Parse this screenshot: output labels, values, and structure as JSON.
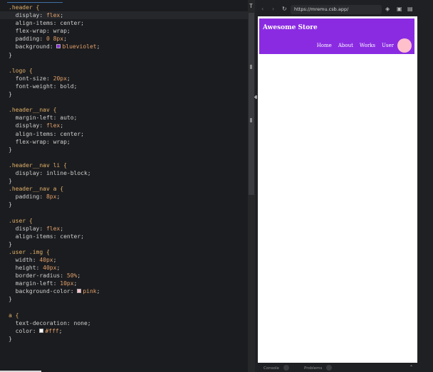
{
  "editor": {
    "lines": [
      [
        {
          "t": ".header {",
          "c": "sel"
        }
      ],
      [
        {
          "t": "  display: ",
          "c": "prop"
        },
        {
          "t": "flex",
          "c": "val"
        },
        {
          "t": ";",
          "c": "prop"
        }
      ],
      [
        {
          "t": "  align-items: center;",
          "c": "prop"
        }
      ],
      [
        {
          "t": "  flex-wrap: wrap;",
          "c": "prop"
        }
      ],
      [
        {
          "t": "  padding: ",
          "c": "prop"
        },
        {
          "t": "0 8px",
          "c": "val"
        },
        {
          "t": ";",
          "c": "prop"
        }
      ],
      [
        {
          "t": "  background: ",
          "c": "prop"
        },
        {
          "sw": "#8a2be2"
        },
        {
          "t": "blueviolet",
          "c": "val"
        },
        {
          "t": ";",
          "c": "prop"
        }
      ],
      [
        {
          "t": "}",
          "c": "prop"
        }
      ],
      [],
      [
        {
          "t": ".logo {",
          "c": "sel"
        }
      ],
      [
        {
          "t": "  font-size: ",
          "c": "prop"
        },
        {
          "t": "20px",
          "c": "val"
        },
        {
          "t": ";",
          "c": "prop"
        }
      ],
      [
        {
          "t": "  font-weight: bold;",
          "c": "prop"
        }
      ],
      [
        {
          "t": "}",
          "c": "prop"
        }
      ],
      [],
      [
        {
          "t": ".header__nav {",
          "c": "sel"
        }
      ],
      [
        {
          "t": "  margin-left: auto;",
          "c": "prop"
        }
      ],
      [
        {
          "t": "  display: ",
          "c": "prop"
        },
        {
          "t": "flex",
          "c": "val"
        },
        {
          "t": ";",
          "c": "prop"
        }
      ],
      [
        {
          "t": "  align-items: center;",
          "c": "prop"
        }
      ],
      [
        {
          "t": "  flex-wrap: wrap;",
          "c": "prop"
        }
      ],
      [
        {
          "t": "}",
          "c": "prop"
        }
      ],
      [],
      [
        {
          "t": ".header__nav li {",
          "c": "sel"
        }
      ],
      [
        {
          "t": "  display: inline-block;",
          "c": "prop"
        }
      ],
      [
        {
          "t": "}",
          "c": "prop"
        }
      ],
      [
        {
          "t": ".header__nav a {",
          "c": "sel"
        }
      ],
      [
        {
          "t": "  padding: ",
          "c": "prop"
        },
        {
          "t": "8px",
          "c": "val"
        },
        {
          "t": ";",
          "c": "prop"
        }
      ],
      [
        {
          "t": "}",
          "c": "prop"
        }
      ],
      [],
      [
        {
          "t": ".user {",
          "c": "sel"
        }
      ],
      [
        {
          "t": "  display: ",
          "c": "prop"
        },
        {
          "t": "flex",
          "c": "val"
        },
        {
          "t": ";",
          "c": "prop"
        }
      ],
      [
        {
          "t": "  align-items: center;",
          "c": "prop"
        }
      ],
      [
        {
          "t": "}",
          "c": "prop"
        }
      ],
      [
        {
          "t": ".user .img {",
          "c": "sel"
        }
      ],
      [
        {
          "t": "  width: ",
          "c": "prop"
        },
        {
          "t": "40px",
          "c": "val"
        },
        {
          "t": ";",
          "c": "prop"
        }
      ],
      [
        {
          "t": "  height: ",
          "c": "prop"
        },
        {
          "t": "40px",
          "c": "val"
        },
        {
          "t": ";",
          "c": "prop"
        }
      ],
      [
        {
          "t": "  border-radius: ",
          "c": "prop"
        },
        {
          "t": "50%",
          "c": "val"
        },
        {
          "t": ";",
          "c": "prop"
        }
      ],
      [
        {
          "t": "  margin-left: ",
          "c": "prop"
        },
        {
          "t": "10px",
          "c": "val"
        },
        {
          "t": ";",
          "c": "prop"
        }
      ],
      [
        {
          "t": "  background-color: ",
          "c": "prop"
        },
        {
          "sw": "#ffc0cb"
        },
        {
          "t": "pink",
          "c": "val"
        },
        {
          "t": ";",
          "c": "prop"
        }
      ],
      [
        {
          "t": "}",
          "c": "prop"
        }
      ],
      [],
      [
        {
          "t": "a {",
          "c": "sel"
        }
      ],
      [
        {
          "t": "  text-decoration: none;",
          "c": "prop"
        }
      ],
      [
        {
          "t": "  color: ",
          "c": "prop"
        },
        {
          "sw": "#ffffff"
        },
        {
          "t": "#fff",
          "c": "val"
        },
        {
          "t": ";",
          "c": "prop"
        }
      ],
      [
        {
          "t": "}",
          "c": "prop"
        }
      ]
    ],
    "highlighted_line": 1
  },
  "browser": {
    "url": "https://mremu.csb.app/",
    "icons": [
      "back-icon",
      "forward-icon",
      "reload-icon",
      "open-external-icon",
      "split-icon",
      "new-window-icon"
    ]
  },
  "site": {
    "logo": "Awesome Store",
    "nav": [
      "Home",
      "About",
      "Works"
    ],
    "user_label": "User",
    "header_color": "#8a2be2",
    "avatar_color": "#ffc0cb"
  },
  "bottom": {
    "console_label": "Console",
    "console_count": "0",
    "problems_label": "Problems",
    "problems_count": "0"
  }
}
